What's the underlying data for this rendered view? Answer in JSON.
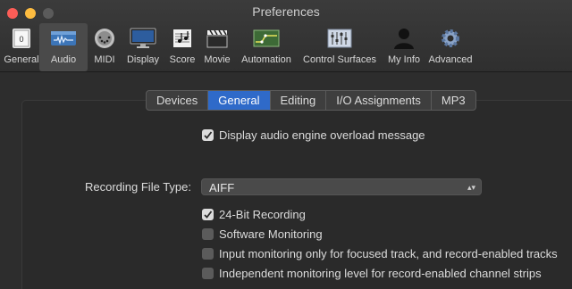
{
  "window": {
    "title": "Preferences"
  },
  "toolbar": {
    "items": [
      {
        "label": "General",
        "icon": "general-icon"
      },
      {
        "label": "Audio",
        "icon": "audio-icon",
        "active": true
      },
      {
        "label": "MIDI",
        "icon": "midi-icon"
      },
      {
        "label": "Display",
        "icon": "display-icon"
      },
      {
        "label": "Score",
        "icon": "score-icon"
      },
      {
        "label": "Movie",
        "icon": "movie-icon"
      },
      {
        "label": "Automation",
        "icon": "automation-icon"
      },
      {
        "label": "Control Surfaces",
        "icon": "control-surfaces-icon"
      },
      {
        "label": "My Info",
        "icon": "my-info-icon"
      },
      {
        "label": "Advanced",
        "icon": "advanced-icon"
      }
    ]
  },
  "tabs": [
    {
      "label": "Devices"
    },
    {
      "label": "General",
      "selected": true
    },
    {
      "label": "Editing"
    },
    {
      "label": "I/O Assignments"
    },
    {
      "label": "MP3"
    }
  ],
  "options": {
    "overload_message": {
      "label": "Display audio engine overload message",
      "checked": true
    },
    "recording_file_type": {
      "label": "Recording File Type:",
      "value": "AIFF"
    },
    "bit24": {
      "label": "24-Bit Recording",
      "checked": true
    },
    "software_monitoring": {
      "label": "Software Monitoring",
      "checked": false
    },
    "input_monitoring": {
      "label": "Input monitoring only for focused track, and record-enabled tracks",
      "checked": false
    },
    "independent_monitoring": {
      "label": "Independent monitoring level for record-enabled channel strips",
      "checked": false
    }
  },
  "colors": {
    "accent": "#2f6ac9",
    "background": "#2d2d2d"
  }
}
